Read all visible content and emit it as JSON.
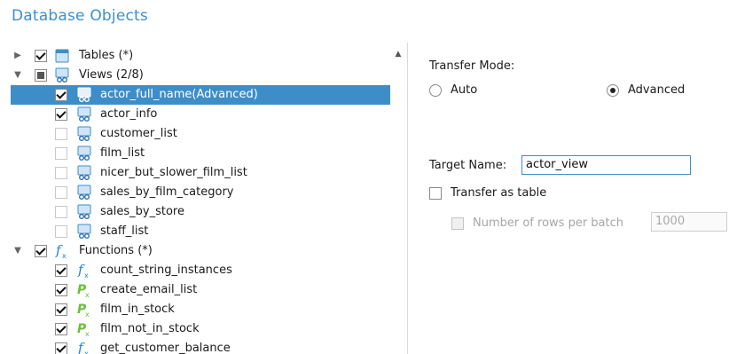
{
  "header": {
    "title": "Database Objects"
  },
  "tree": {
    "tables": {
      "label": "Tables (*)"
    },
    "views": {
      "label": "Views (2/8)",
      "items": [
        {
          "label": "actor_full_name(Advanced)"
        },
        {
          "label": "actor_info"
        },
        {
          "label": "customer_list"
        },
        {
          "label": "film_list"
        },
        {
          "label": "nicer_but_slower_film_list"
        },
        {
          "label": "sales_by_film_category"
        },
        {
          "label": "sales_by_store"
        },
        {
          "label": "staff_list"
        }
      ]
    },
    "functions": {
      "label": "Functions (*)",
      "items": [
        {
          "label": "count_string_instances"
        },
        {
          "label": "create_email_list"
        },
        {
          "label": "film_in_stock"
        },
        {
          "label": "film_not_in_stock"
        },
        {
          "label": "get_customer_balance"
        }
      ]
    }
  },
  "settings": {
    "transfer_mode_label": "Transfer Mode:",
    "mode_auto": "Auto",
    "mode_advanced": "Advanced",
    "target_name_label": "Target Name:",
    "target_name_value": "actor_view",
    "transfer_as_table": "Transfer as table",
    "rows_per_batch_label": "Number of rows per batch",
    "rows_per_batch_value": "1000"
  },
  "colors": {
    "accent": "#3d8ec8",
    "title": "#3b8fd0",
    "function_icon": "#1f7fd4",
    "procedure_icon": "#6abf3a"
  }
}
